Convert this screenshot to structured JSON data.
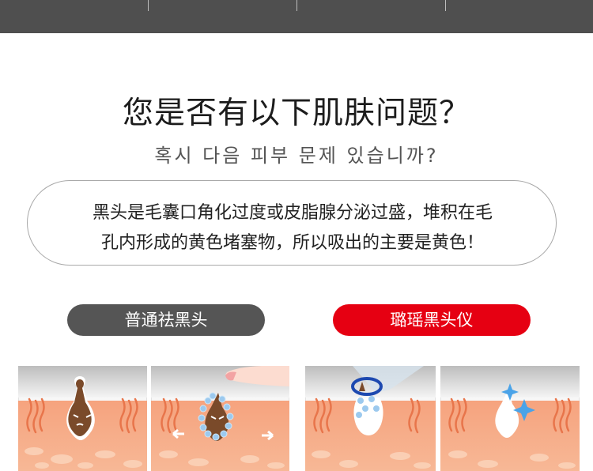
{
  "header": {
    "bar_color": "#4f4f4f"
  },
  "heading": {
    "title": "您是否有以下肌肤问题？",
    "subtitle": "혹시 다음 피부 문제 있습니까?"
  },
  "description": {
    "line1": "黑头是毛囊口角化过度或皮脂腺分泌过盛，堆积在毛",
    "line2": "孔内形成的黄色堵塞物，所以吸出的主要是黄色！"
  },
  "comparison": {
    "ordinary_label": "普通祛黑头",
    "ordinary_color": "#555555",
    "device_label": "璐瑶黑头仪",
    "device_color": "#e60012"
  },
  "panels": [
    {
      "icon": "blackhead-pore-icon"
    },
    {
      "icon": "finger-squeeze-icon"
    },
    {
      "icon": "suction-device-icon"
    },
    {
      "icon": "clean-pore-sparkle-icon"
    }
  ]
}
